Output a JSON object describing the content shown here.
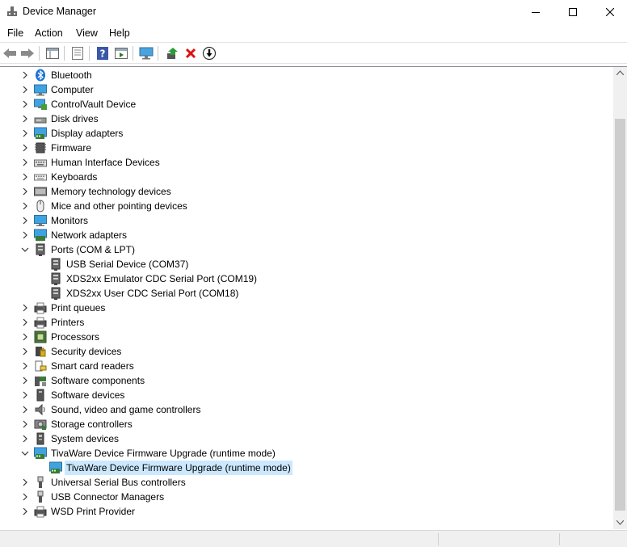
{
  "window": {
    "title": "Device Manager"
  },
  "menu": {
    "items": [
      "File",
      "Action",
      "View",
      "Help"
    ]
  },
  "toolbar": {
    "buttons": [
      "back-icon",
      "forward-icon",
      "show-hide-tree-icon",
      "properties-icon",
      "help-icon",
      "run-icon",
      "scan-hardware-icon",
      "update-driver-icon",
      "uninstall-icon",
      "disable-device-icon"
    ]
  },
  "tree": [
    {
      "label": "Bluetooth",
      "icon": "bluetooth-icon",
      "level": 0,
      "expanded": false
    },
    {
      "label": "Computer",
      "icon": "computer-icon",
      "level": 0,
      "expanded": false
    },
    {
      "label": "ControlVault Device",
      "icon": "controlvault-icon",
      "level": 0,
      "expanded": false
    },
    {
      "label": "Disk drives",
      "icon": "disk-drive-icon",
      "level": 0,
      "expanded": false
    },
    {
      "label": "Display adapters",
      "icon": "display-adapter-icon",
      "level": 0,
      "expanded": false
    },
    {
      "label": "Firmware",
      "icon": "firmware-icon",
      "level": 0,
      "expanded": false
    },
    {
      "label": "Human Interface Devices",
      "icon": "hid-icon",
      "level": 0,
      "expanded": false
    },
    {
      "label": "Keyboards",
      "icon": "keyboard-icon",
      "level": 0,
      "expanded": false
    },
    {
      "label": "Memory technology devices",
      "icon": "memory-icon",
      "level": 0,
      "expanded": false
    },
    {
      "label": "Mice and other pointing devices",
      "icon": "mouse-icon",
      "level": 0,
      "expanded": false
    },
    {
      "label": "Monitors",
      "icon": "monitor-icon",
      "level": 0,
      "expanded": false
    },
    {
      "label": "Network adapters",
      "icon": "network-adapter-icon",
      "level": 0,
      "expanded": false
    },
    {
      "label": "Ports (COM & LPT)",
      "icon": "port-icon",
      "level": 0,
      "expanded": true
    },
    {
      "label": "USB Serial Device (COM37)",
      "icon": "port-icon",
      "level": 1
    },
    {
      "label": "XDS2xx Emulator CDC Serial Port (COM19)",
      "icon": "port-icon",
      "level": 1
    },
    {
      "label": "XDS2xx User CDC Serial Port (COM18)",
      "icon": "port-icon",
      "level": 1
    },
    {
      "label": "Print queues",
      "icon": "print-queue-icon",
      "level": 0,
      "expanded": false
    },
    {
      "label": "Printers",
      "icon": "printer-icon",
      "level": 0,
      "expanded": false
    },
    {
      "label": "Processors",
      "icon": "processor-icon",
      "level": 0,
      "expanded": false
    },
    {
      "label": "Security devices",
      "icon": "security-device-icon",
      "level": 0,
      "expanded": false
    },
    {
      "label": "Smart card readers",
      "icon": "smart-card-icon",
      "level": 0,
      "expanded": false
    },
    {
      "label": "Software components",
      "icon": "software-component-icon",
      "level": 0,
      "expanded": false
    },
    {
      "label": "Software devices",
      "icon": "software-device-icon",
      "level": 0,
      "expanded": false
    },
    {
      "label": "Sound, video and game controllers",
      "icon": "sound-icon",
      "level": 0,
      "expanded": false
    },
    {
      "label": "Storage controllers",
      "icon": "storage-controller-icon",
      "level": 0,
      "expanded": false
    },
    {
      "label": "System devices",
      "icon": "system-device-icon",
      "level": 0,
      "expanded": false
    },
    {
      "label": "TivaWare Device Firmware Upgrade (runtime mode)",
      "icon": "display-adapter-icon",
      "level": 0,
      "expanded": true
    },
    {
      "label": "TivaWare Device Firmware Upgrade (runtime mode)",
      "icon": "display-adapter-icon",
      "level": 1,
      "selected": true
    },
    {
      "label": "Universal Serial Bus controllers",
      "icon": "usb-icon",
      "level": 0,
      "expanded": false
    },
    {
      "label": "USB Connector Managers",
      "icon": "usb-icon",
      "level": 0,
      "expanded": false
    },
    {
      "label": "WSD Print Provider",
      "icon": "printer-icon",
      "level": 0,
      "expanded": false
    }
  ],
  "colors": {
    "selection": "#cce8ff",
    "accent": "#0078d7"
  }
}
